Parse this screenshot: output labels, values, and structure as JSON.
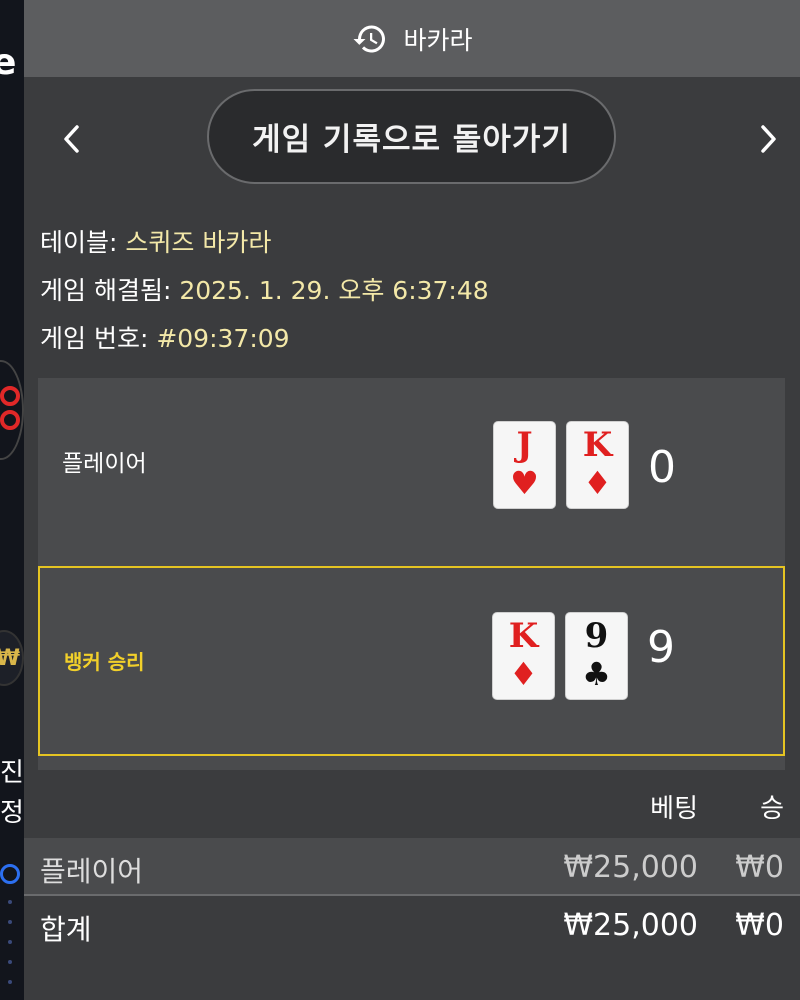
{
  "header": {
    "title": "바카라",
    "icon": "history-icon"
  },
  "nav": {
    "back_label": "게임 기록으로 돌아가기",
    "prev_icon": "chevron-left-icon",
    "next_icon": "chevron-right-icon"
  },
  "info": {
    "table_label": "테이블:",
    "table_value": "스퀴즈 바카라",
    "resolved_label": "게임 해결됨:",
    "resolved_value": "2025. 1. 29. 오후 6:37:48",
    "number_label": "게임 번호:",
    "number_value": "#09:37:09"
  },
  "hands": {
    "player": {
      "label": "플레이어",
      "score": "0",
      "cards": [
        {
          "rank": "J",
          "suit": "♥",
          "color": "red"
        },
        {
          "rank": "K",
          "suit": "♦",
          "color": "red"
        }
      ]
    },
    "banker": {
      "label": "뱅커 승리",
      "score": "9",
      "cards": [
        {
          "rank": "K",
          "suit": "♦",
          "color": "red"
        },
        {
          "rank": "9",
          "suit": "♣",
          "color": "black"
        }
      ]
    }
  },
  "bets": {
    "col_bet": "베팅",
    "col_win": "승",
    "rows": [
      {
        "name": "플레이어",
        "amount": "₩25,000",
        "win": "₩0"
      }
    ],
    "total": {
      "name": "합계",
      "amount": "₩25,000",
      "win": "₩0"
    }
  },
  "colors": {
    "highlight": "#e5c422",
    "value_text": "#f3e8a8",
    "panel": "#3b3c3e"
  },
  "background": {
    "text1": "진",
    "text2": "정",
    "currency": "₩"
  }
}
